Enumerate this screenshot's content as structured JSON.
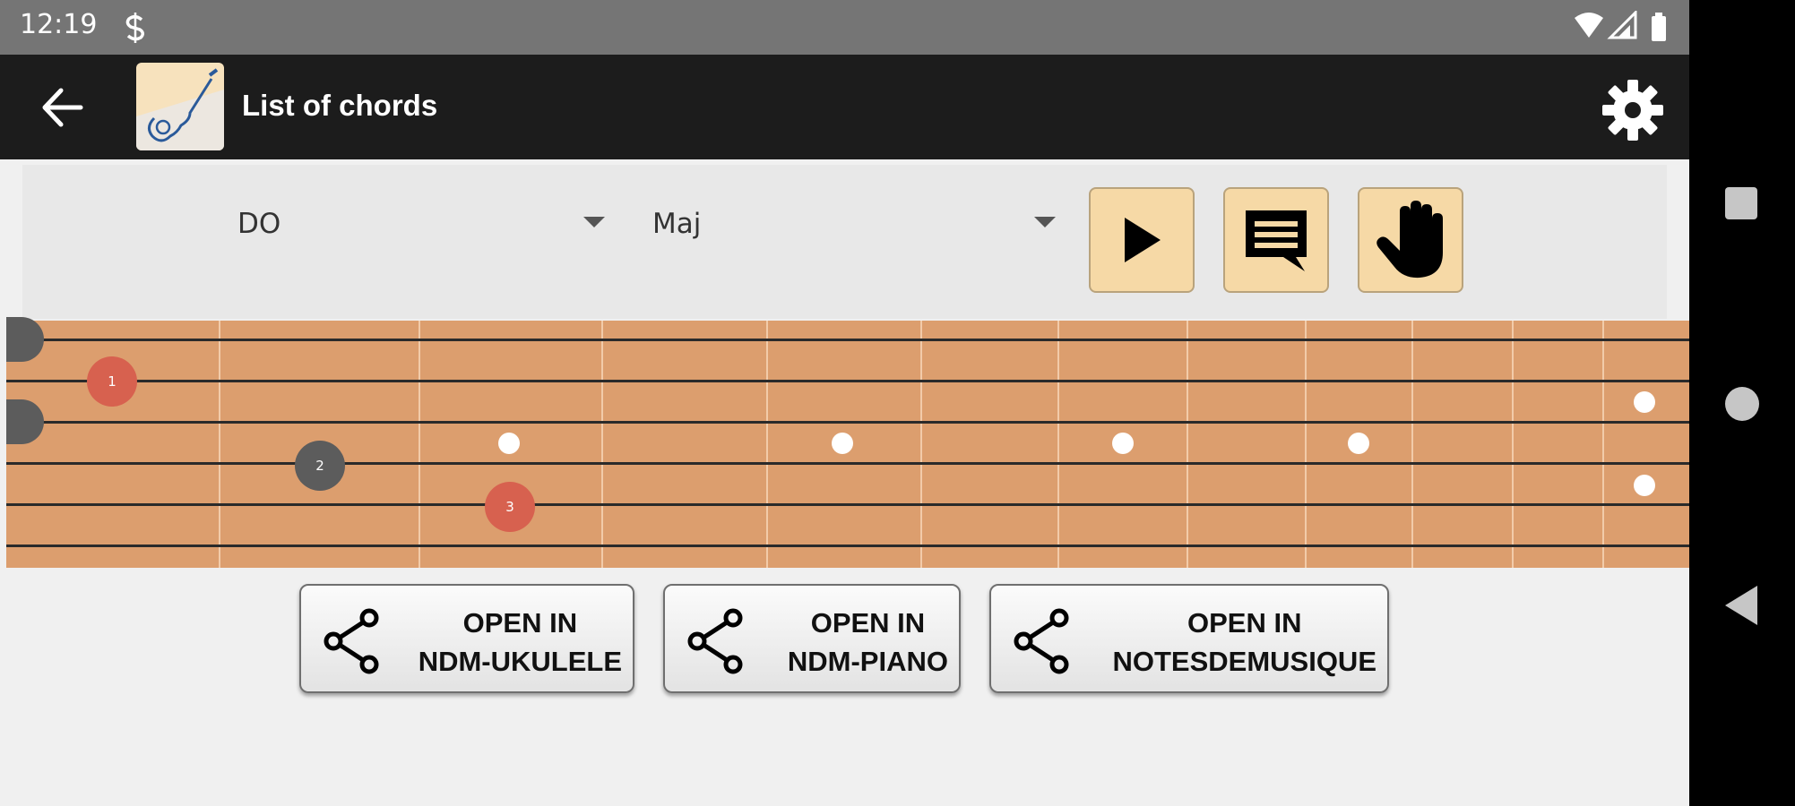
{
  "status_bar": {
    "time": "12:19"
  },
  "app_bar": {
    "title": "List of chords"
  },
  "controls": {
    "note_value": "DO",
    "type_value": "Maj"
  },
  "fretboard": {
    "fingers": [
      {
        "label": "1",
        "color": "#d7614f"
      },
      {
        "label": "2",
        "color": "#5c5c5c"
      },
      {
        "label": "3",
        "color": "#d7614f"
      }
    ]
  },
  "open_buttons": [
    {
      "line1": "OPEN IN",
      "line2": "NDM-UKULELE"
    },
    {
      "line1": "OPEN IN",
      "line2": "NDM-PIANO"
    },
    {
      "line1": "OPEN IN",
      "line2": "NOTESDEMUSIQUE"
    }
  ],
  "colors": {
    "appbar": "#1c1c1c",
    "accent_button": "#f6d9a6",
    "fretboard": "#dc9e6e"
  }
}
